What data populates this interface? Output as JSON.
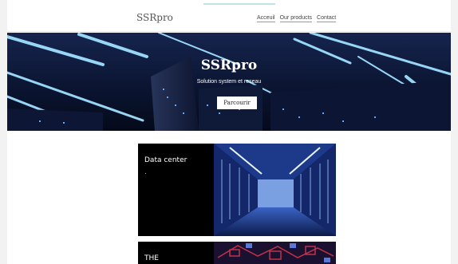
{
  "brand": "SSRpro",
  "nav": {
    "links": [
      "Acceuil",
      "Our products",
      "Contact"
    ]
  },
  "hero": {
    "title": "SSRpro",
    "subtitle": "Solution system et reseau",
    "button_label": "Parcourir"
  },
  "cards": [
    {
      "title": "Data center"
    },
    {
      "title": "THE"
    }
  ],
  "colors": {
    "hero_bg": "#0b1633",
    "card_bg": "#000000",
    "light_beam": "#8fd8ff",
    "circuit_red": "#c0334a"
  }
}
